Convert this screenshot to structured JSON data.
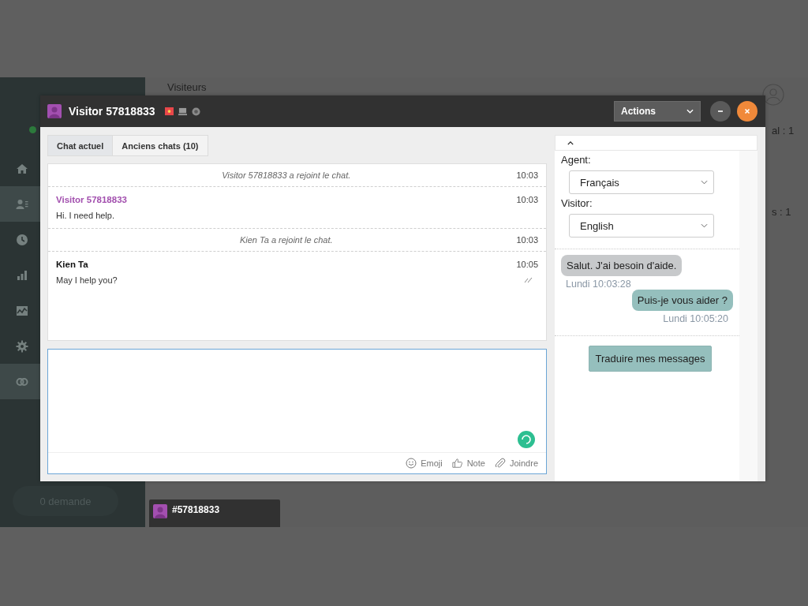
{
  "background_app": {
    "heading": "Visiteurs",
    "sidebar": {
      "items": [
        {
          "selected": false
        },
        {
          "selected": true
        },
        {
          "selected": false
        },
        {
          "selected": false
        },
        {
          "selected": false
        },
        {
          "selected": false
        },
        {
          "selected": true
        }
      ]
    },
    "requests": "0 demande",
    "stats": [
      "al : 1",
      "s : 1"
    ]
  },
  "chat_window": {
    "title": "Visitor 57818833",
    "actions": "Actions",
    "tabs": [
      {
        "label": "Chat actuel",
        "selected": true
      },
      {
        "label": "Anciens chats (10)",
        "selected": false
      }
    ],
    "messages": [
      {
        "kind": "event",
        "text": "Visitor 57818833 a rejoint le chat.",
        "time": "10:03"
      },
      {
        "kind": "visitor_message",
        "author": "Visitor 57818833",
        "text": "Hi. I need help.",
        "time": "10:03",
        "read": false
      },
      {
        "kind": "event",
        "text": "Kien Ta a rejoint le chat.",
        "time": "10:03"
      },
      {
        "kind": "agent_message",
        "author": "Kien Ta",
        "text": "May I help you?",
        "time": "10:05",
        "read": true
      }
    ],
    "composer": {
      "tools": [
        "Emoji",
        "Note",
        "Joindre"
      ]
    },
    "translation": {
      "agent_label": "Agent:",
      "agent_language": "Français",
      "visitor_label": "Visitor:",
      "visitor_language": "English",
      "messages": [
        {
          "kind": "incoming",
          "text": "Salut. J'ai besoin d'aide.",
          "time": "Lundi 10:03:28"
        },
        {
          "kind": "outgoing",
          "text": "Puis-je vous aider ?",
          "time": "Lundi 10:05:20"
        }
      ],
      "button": "Traduire mes messages"
    }
  },
  "minimized_chats": [
    {
      "label": "#57818833"
    }
  ]
}
